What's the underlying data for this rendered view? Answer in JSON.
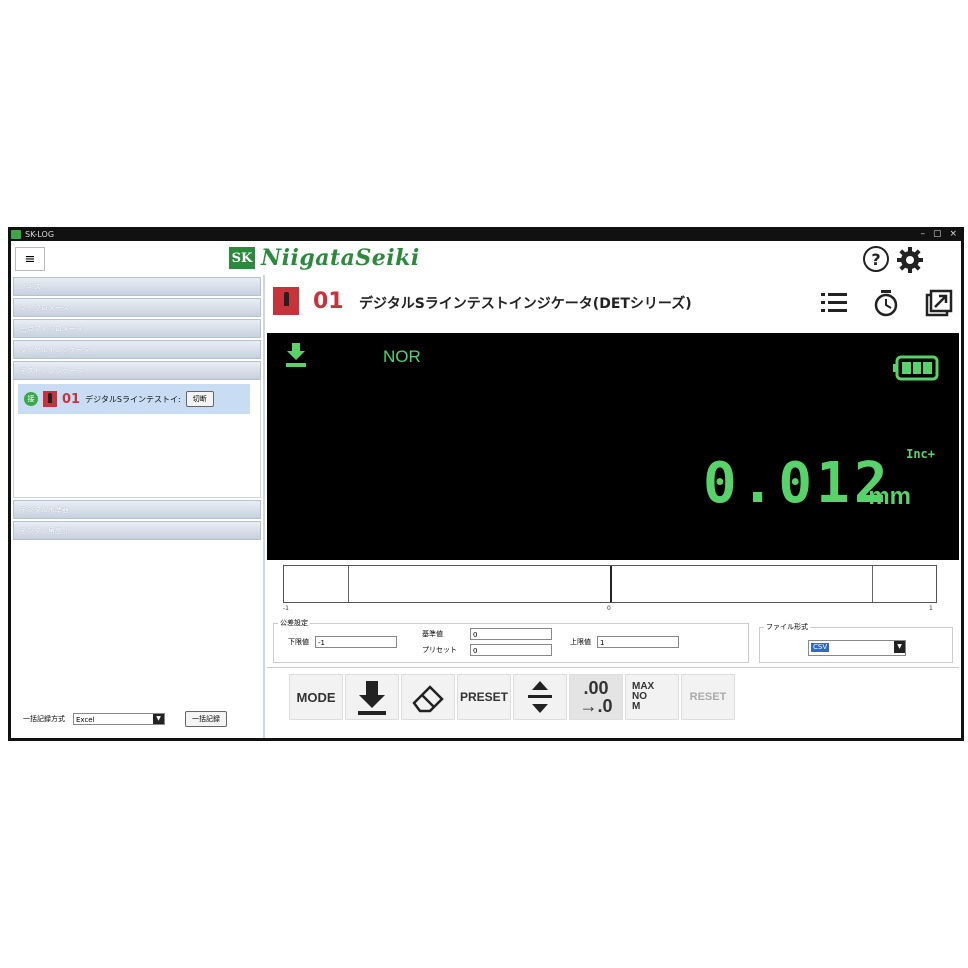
{
  "window": {
    "title": "SK-LOG",
    "controls": [
      "–",
      "▢",
      "×"
    ]
  },
  "header": {
    "logo_mark": "SK",
    "logo_text": "NiigataSeiki",
    "help_glyph": "?"
  },
  "sidebar": {
    "sections": [
      {
        "label": "ノギス"
      },
      {
        "label": "マイクロメータ"
      },
      {
        "label": "三点マイクロメータ"
      },
      {
        "label": "ダイヤルインジケータ"
      },
      {
        "label": "テストインジケータ"
      }
    ],
    "device_item": {
      "status": "接",
      "number": "01",
      "name": "デジタルSラインテストイ:",
      "button": "切断"
    },
    "sections_lower": [
      {
        "label": "デジタル水準器"
      },
      {
        "label": "デジタル角度計"
      }
    ],
    "footer": {
      "label": "一括記録方式",
      "select_value": "Excel",
      "button": "一括記録"
    }
  },
  "device": {
    "number": "01",
    "title": "デジタルSラインテストインジケータ(DETシリーズ)"
  },
  "display": {
    "mode": "NOR",
    "direction": "Inc+",
    "reading": "0.012",
    "unit": "mm",
    "battery_level": 1.0,
    "accent_color": "#58d26a"
  },
  "gauge": {
    "min_label": "-1",
    "mid_label": "0",
    "max_label": "1"
  },
  "tolerance": {
    "legend": "公差設定",
    "lower_label": "下限値",
    "lower_value": "-1",
    "base_label": "基準値",
    "base_value": "0",
    "preset_label": "プリセット",
    "preset_value": "0",
    "upper_label": "上限値",
    "upper_value": "1"
  },
  "file_format": {
    "legend": "ファイル形式",
    "value": "CSV"
  },
  "toolbar": {
    "mode": "MODE",
    "preset": "PRESET",
    "decimal_top": ".00",
    "decimal_bottom": "→.0",
    "maxnom_1": "MAX",
    "maxnom_2": "NO",
    "maxnom_3": "M",
    "reset": "RESET"
  }
}
